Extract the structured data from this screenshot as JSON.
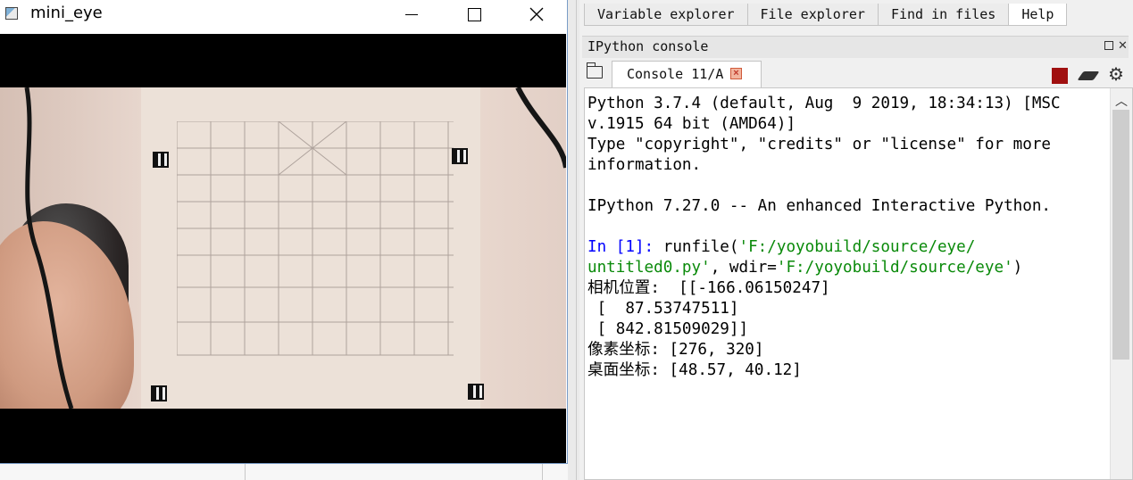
{
  "cv_window": {
    "title": "mini_eye",
    "buttons": {
      "minimize": "minimize",
      "maximize": "maximize",
      "close": "close"
    },
    "accent": "#7a9cc7"
  },
  "spyder": {
    "tabs": [
      "Variable explorer",
      "File explorer",
      "Find in files",
      "Help"
    ],
    "active_tab": "Help",
    "console_pane_title": "IPython console",
    "console_tab_label": "Console 11/A",
    "console": {
      "banner_1": "Python 3.7.4 (default, Aug  9 2019, 18:34:13) [MSC",
      "banner_2": "v.1915 64 bit (AMD64)]",
      "banner_3": "Type \"copyright\", \"credits\" or \"license\" for more",
      "banner_4": "information.",
      "banner_5": "IPython 7.27.0 -- An enhanced Interactive Python.",
      "prompt": "In [1]:",
      "cmd_func": " runfile(",
      "cmd_arg1_a": "'F:/yoyobuild/source/eye/",
      "cmd_arg1_b": "untitled0.py'",
      "cmd_mid": ", wdir=",
      "cmd_arg2": "'F:/yoyobuild/source/eye'",
      "cmd_end": ")",
      "out_1": "相机位置:  [[-166.06150247]",
      "out_2": " [  87.53747511]",
      "out_3": " [ 842.81509029]]",
      "out_4": "像素坐标: [276, 320]",
      "out_5": "桌面坐标: [48.57, 40.12]"
    },
    "colors": {
      "string": "#0a8a0a",
      "prompt": "#0000ff",
      "stop": "#a01010"
    }
  }
}
